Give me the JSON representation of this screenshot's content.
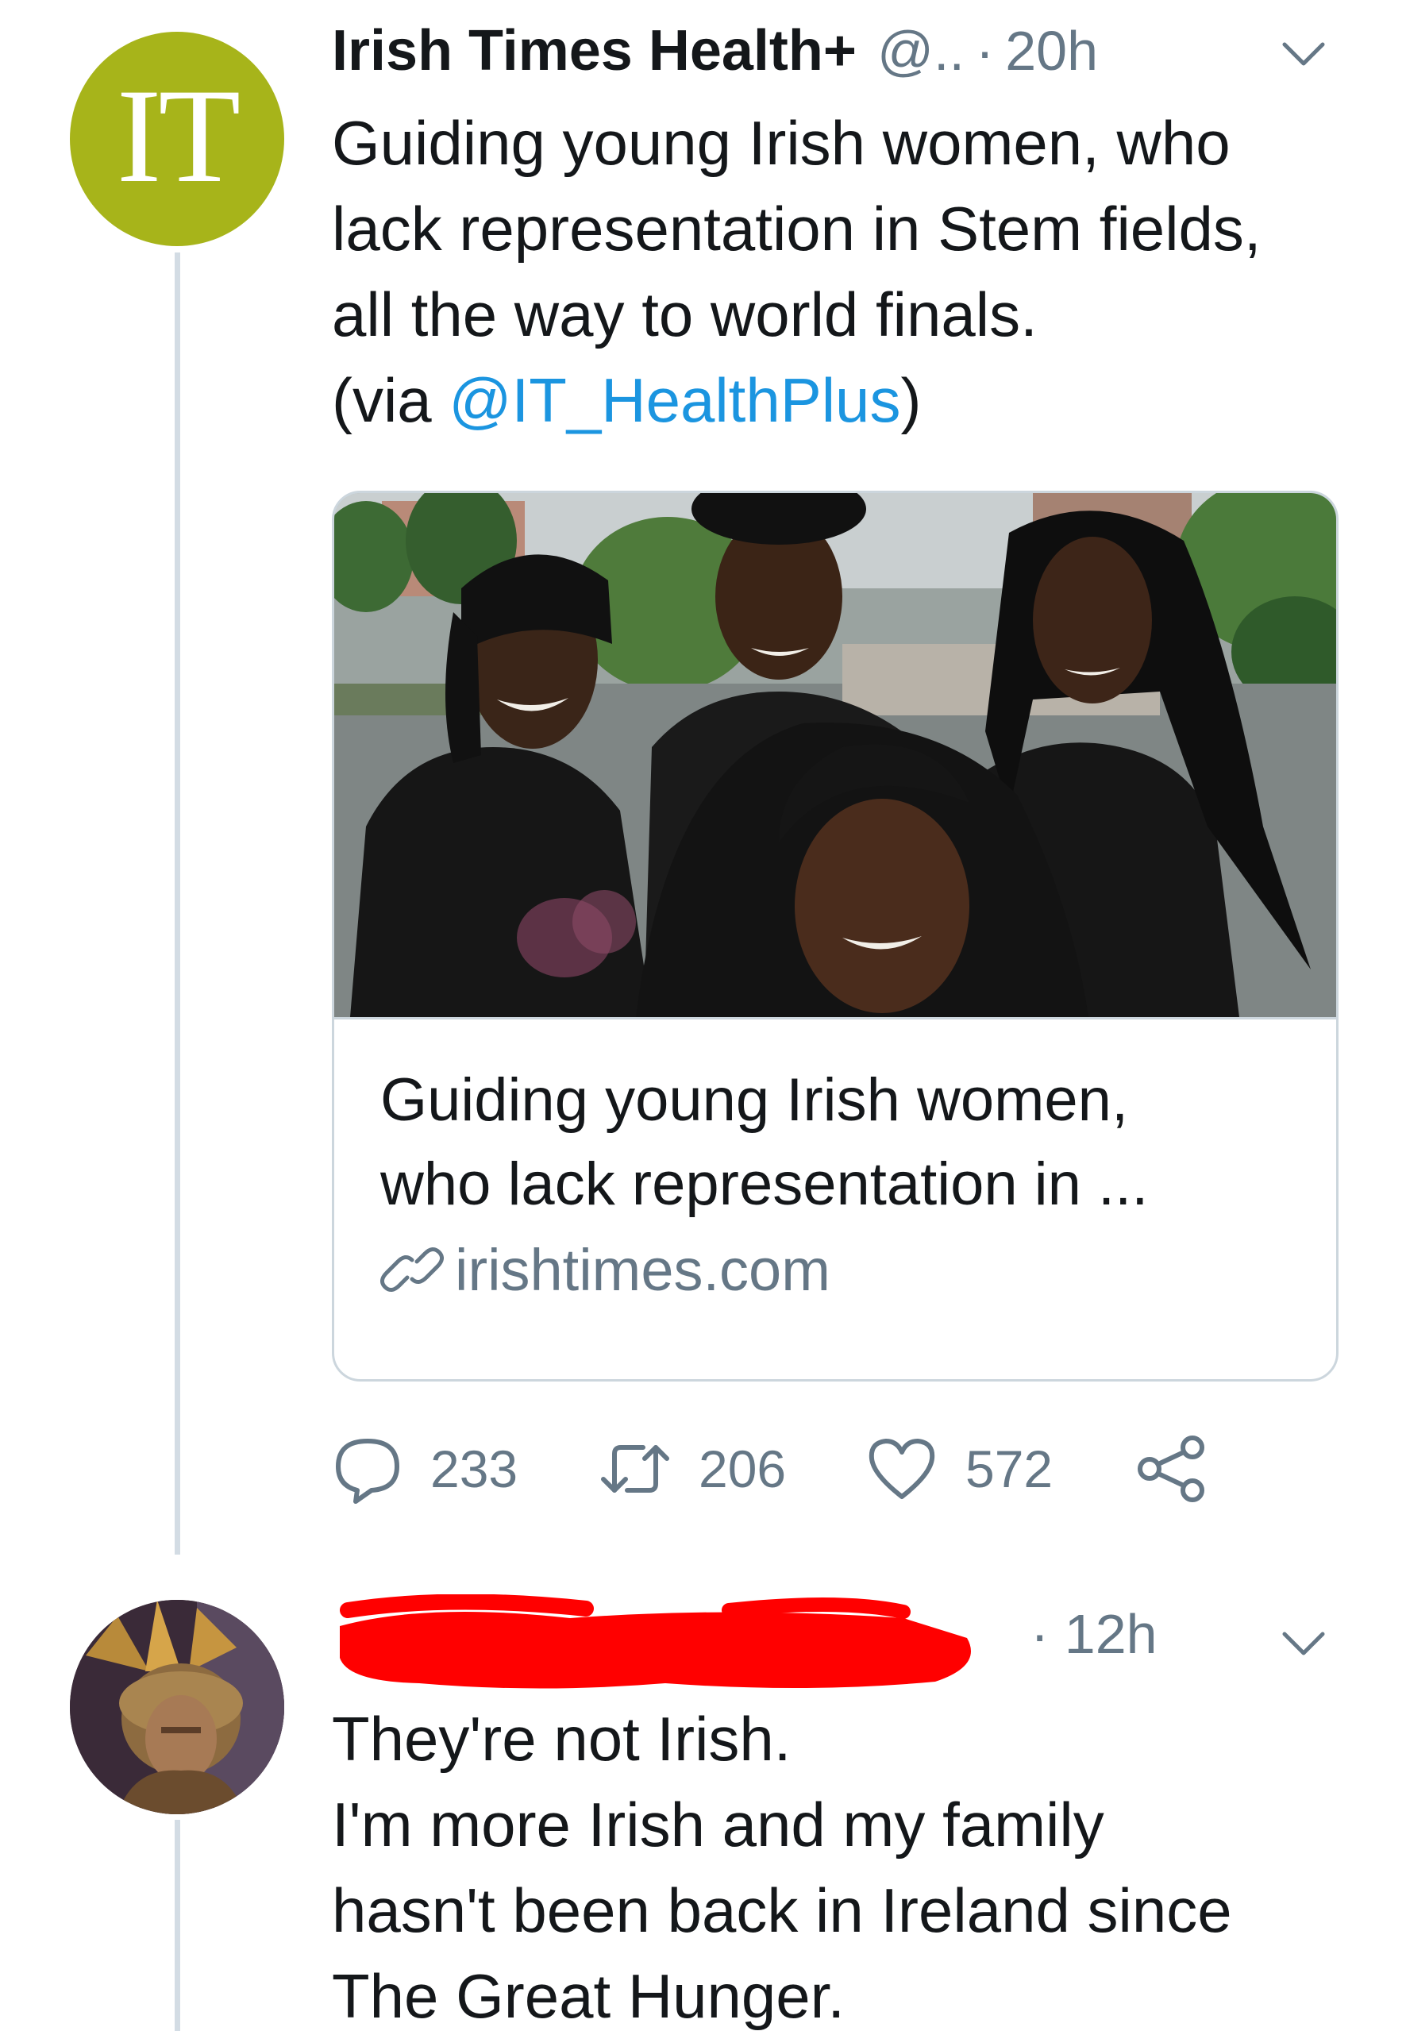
{
  "tweet": {
    "author": {
      "avatar_text": "IT",
      "name": "Irish Times Health+",
      "handle": "@..",
      "time": "20h"
    },
    "text_lines": [
      "Guiding young Irish women, who",
      "lack representation in Stem fields,",
      "all the way to world finals."
    ],
    "via_prefix": "(via ",
    "via_mention": "@IT_HealthPlus",
    "via_suffix": ")",
    "card": {
      "title_lines": [
        "Guiding young Irish women,",
        "who lack representation in ..."
      ],
      "domain": "irishtimes.com",
      "image_icon": "photo-four-women-in-black-shirts"
    },
    "actions": {
      "replies": "233",
      "retweets": "206",
      "likes": "572"
    }
  },
  "reply": {
    "avatar_icon": "roman-helmet-avatar",
    "time": "12h",
    "name_redacted": true,
    "text_lines": [
      "They're not Irish.",
      "I'm more Irish and my family",
      "hasn't been back in Ireland since",
      "The Great Hunger."
    ]
  },
  "colors": {
    "text": "#14171a",
    "secondary": "#657786",
    "link": "#1b95e0",
    "border": "#ccd6dd",
    "thread_line": "#d3dce4",
    "it_avatar": "#a7b41a",
    "redaction": "#ff0000"
  }
}
